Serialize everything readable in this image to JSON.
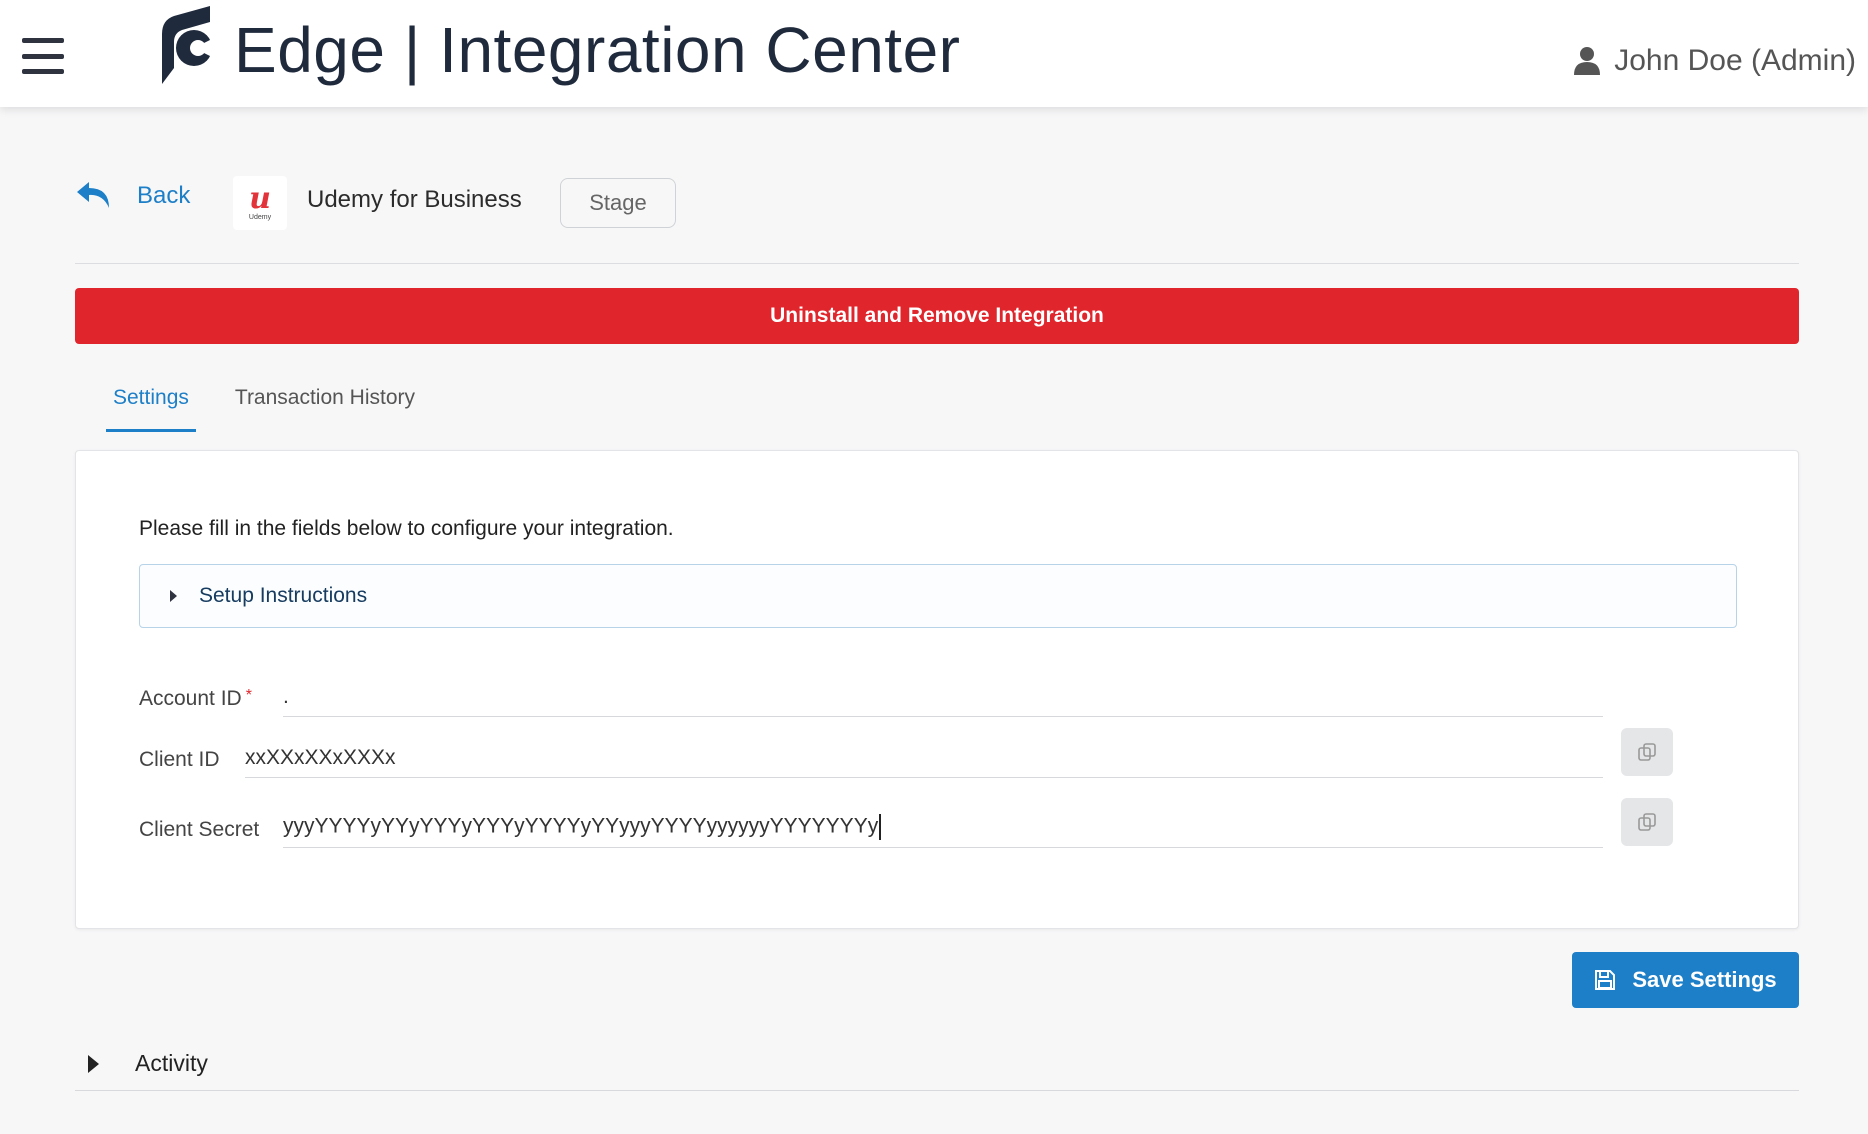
{
  "header": {
    "title": "Edge | Integration Center",
    "user": "John Doe (Admin)"
  },
  "nav": {
    "back_label": "Back",
    "vendor_name": "Udemy for Business",
    "vendor_logo_text": "u",
    "vendor_logo_subtext": "Udemy",
    "environment_label": "Stage"
  },
  "actions": {
    "uninstall_label": "Uninstall and Remove Integration",
    "save_label": "Save Settings"
  },
  "tabs": [
    {
      "label": "Settings",
      "active": true
    },
    {
      "label": "Transaction History",
      "active": false
    }
  ],
  "settings": {
    "intro": "Please fill in the fields below to configure your integration.",
    "instructions_label": "Setup Instructions",
    "fields": {
      "account_id": {
        "label": "Account ID",
        "required_mark": "*",
        "value": "."
      },
      "client_id": {
        "label": "Client ID",
        "value": "xxXXxXXxXXXx"
      },
      "client_secret": {
        "label": "Client Secret",
        "value": "yyyYYYYyYYyYYYyYYYyYYYYyYYyyyYYYYyyyyyyYYYYYYYy"
      }
    }
  },
  "activity": {
    "label": "Activity"
  },
  "colors": {
    "accent": "#1d7fc7",
    "danger": "#e0262c",
    "title": "#1f2a3c"
  }
}
